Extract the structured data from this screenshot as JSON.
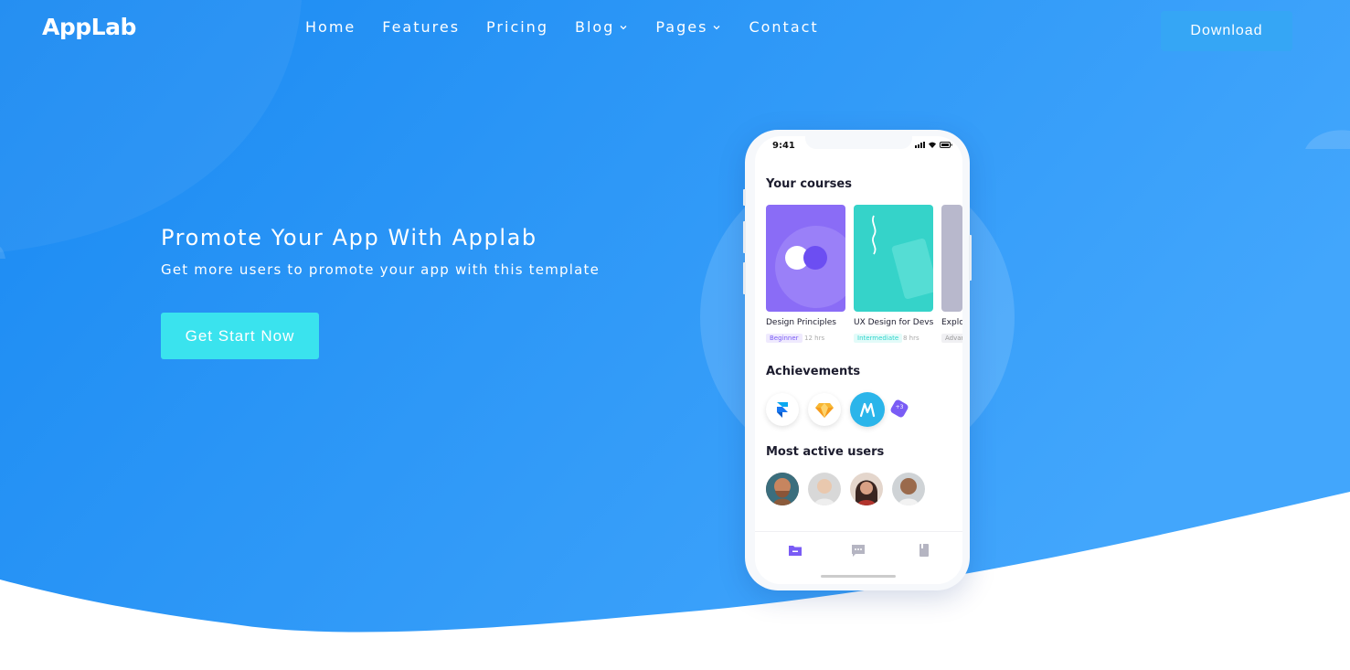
{
  "header": {
    "logo": "AppLab",
    "nav": [
      {
        "label": "Home"
      },
      {
        "label": "Features"
      },
      {
        "label": "Pricing"
      },
      {
        "label": "Blog"
      },
      {
        "label": "Pages"
      },
      {
        "label": "Contact"
      }
    ],
    "download_label": "Download"
  },
  "hero": {
    "title": "Promote Your App With Applab",
    "subtitle": "Get more users to promote your app with this template",
    "cta_label": "Get Start Now"
  },
  "phone": {
    "time": "9:41",
    "courses_title": "Your courses",
    "courses": [
      {
        "name": "Design Principles",
        "level": "Beginner",
        "hours": "12 hrs",
        "level_color": "#7a5cf5"
      },
      {
        "name": "UX Design for Devs",
        "level": "Intermediate",
        "hours": "8 hrs",
        "level_color": "#2fd5cc"
      },
      {
        "name": "Explor",
        "level": "Advar",
        "hours": ""
      }
    ],
    "achievements_title": "Achievements",
    "achievements_more": "+3",
    "users_title": "Most active users"
  },
  "colors": {
    "hero_start": "#1a8cf4",
    "hero_end": "#3fa3fb",
    "cta": "#3ae3ee",
    "download": "#35a6f5"
  }
}
